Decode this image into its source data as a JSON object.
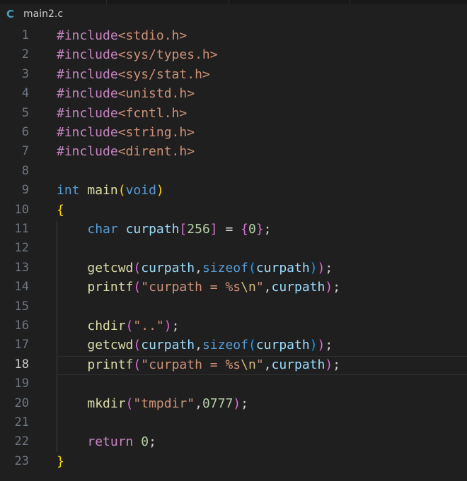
{
  "tab": {
    "icon": "c-language-icon",
    "icon_glyph": "C",
    "filename": "main2.c"
  },
  "active_line": 18,
  "lines": [
    {
      "n": "1",
      "tokens": [
        [
          "#include",
          "inc"
        ],
        [
          "<stdio.h>",
          "hdr"
        ]
      ]
    },
    {
      "n": "2",
      "tokens": [
        [
          "#include",
          "inc"
        ],
        [
          "<sys/types.h>",
          "hdr"
        ]
      ]
    },
    {
      "n": "3",
      "tokens": [
        [
          "#include",
          "inc"
        ],
        [
          "<sys/stat.h>",
          "hdr"
        ]
      ]
    },
    {
      "n": "4",
      "tokens": [
        [
          "#include",
          "inc"
        ],
        [
          "<unistd.h>",
          "hdr"
        ]
      ]
    },
    {
      "n": "5",
      "tokens": [
        [
          "#include",
          "inc"
        ],
        [
          "<fcntl.h>",
          "hdr"
        ]
      ]
    },
    {
      "n": "6",
      "tokens": [
        [
          "#include",
          "inc"
        ],
        [
          "<string.h>",
          "hdr"
        ]
      ]
    },
    {
      "n": "7",
      "tokens": [
        [
          "#include",
          "inc"
        ],
        [
          "<dirent.h>",
          "hdr"
        ]
      ]
    },
    {
      "n": "8",
      "tokens": []
    },
    {
      "n": "9",
      "tokens": [
        [
          "int",
          "kw"
        ],
        [
          " ",
          "p"
        ],
        [
          "main",
          "fn"
        ],
        [
          "(",
          "b1"
        ],
        [
          "void",
          "kw"
        ],
        [
          ")",
          "b1"
        ]
      ]
    },
    {
      "n": "10",
      "tokens": [
        [
          "{",
          "b1"
        ]
      ]
    },
    {
      "n": "11",
      "tokens": [
        [
          "    ",
          "p"
        ],
        [
          "char",
          "kw"
        ],
        [
          " ",
          "p"
        ],
        [
          "curpath",
          "var"
        ],
        [
          "[",
          "b2"
        ],
        [
          "256",
          "num"
        ],
        [
          "]",
          "b2"
        ],
        [
          " = ",
          "p"
        ],
        [
          "{",
          "b2"
        ],
        [
          "0",
          "num"
        ],
        [
          "}",
          "b2"
        ],
        [
          ";",
          "p"
        ]
      ]
    },
    {
      "n": "12",
      "tokens": []
    },
    {
      "n": "13",
      "tokens": [
        [
          "    ",
          "p"
        ],
        [
          "getcwd",
          "fn"
        ],
        [
          "(",
          "b2"
        ],
        [
          "curpath",
          "var"
        ],
        [
          ",",
          "p"
        ],
        [
          "sizeof",
          "kw"
        ],
        [
          "(",
          "b3"
        ],
        [
          "curpath",
          "var"
        ],
        [
          ")",
          "b3"
        ],
        [
          ")",
          "b2"
        ],
        [
          ";",
          "p"
        ]
      ]
    },
    {
      "n": "14",
      "tokens": [
        [
          "    ",
          "p"
        ],
        [
          "printf",
          "fn"
        ],
        [
          "(",
          "b2"
        ],
        [
          "\"curpath = %s",
          "str"
        ],
        [
          "\\n",
          "esc"
        ],
        [
          "\"",
          "str"
        ],
        [
          ",",
          "p"
        ],
        [
          "curpath",
          "var"
        ],
        [
          ")",
          "b2"
        ],
        [
          ";",
          "p"
        ]
      ]
    },
    {
      "n": "15",
      "tokens": []
    },
    {
      "n": "16",
      "tokens": [
        [
          "    ",
          "p"
        ],
        [
          "chdir",
          "fn"
        ],
        [
          "(",
          "b2"
        ],
        [
          "\"..\"",
          "str"
        ],
        [
          ")",
          "b2"
        ],
        [
          ";",
          "p"
        ]
      ]
    },
    {
      "n": "17",
      "tokens": [
        [
          "    ",
          "p"
        ],
        [
          "getcwd",
          "fn"
        ],
        [
          "(",
          "b2"
        ],
        [
          "curpath",
          "var"
        ],
        [
          ",",
          "p"
        ],
        [
          "sizeof",
          "kw"
        ],
        [
          "(",
          "b3"
        ],
        [
          "curpath",
          "var"
        ],
        [
          ")",
          "b3"
        ],
        [
          ")",
          "b2"
        ],
        [
          ";",
          "p"
        ]
      ]
    },
    {
      "n": "18",
      "tokens": [
        [
          "    ",
          "p"
        ],
        [
          "printf",
          "fn"
        ],
        [
          "(",
          "b2"
        ],
        [
          "\"curpath = %s",
          "str"
        ],
        [
          "\\n",
          "esc"
        ],
        [
          "\"",
          "str"
        ],
        [
          ",",
          "p"
        ],
        [
          "curpath",
          "var"
        ],
        [
          ")",
          "b2"
        ],
        [
          ";",
          "p"
        ]
      ]
    },
    {
      "n": "19",
      "tokens": []
    },
    {
      "n": "20",
      "tokens": [
        [
          "    ",
          "p"
        ],
        [
          "mkdir",
          "fn"
        ],
        [
          "(",
          "b2"
        ],
        [
          "\"tmpdir\"",
          "str"
        ],
        [
          ",",
          "p"
        ],
        [
          "0777",
          "num"
        ],
        [
          ")",
          "b2"
        ],
        [
          ";",
          "p"
        ]
      ]
    },
    {
      "n": "21",
      "tokens": []
    },
    {
      "n": "22",
      "tokens": [
        [
          "    ",
          "p"
        ],
        [
          "return",
          "ctl"
        ],
        [
          " ",
          "p"
        ],
        [
          "0",
          "num"
        ],
        [
          ";",
          "p"
        ]
      ]
    },
    {
      "n": "23",
      "tokens": [
        [
          "}",
          "b1"
        ]
      ]
    }
  ]
}
